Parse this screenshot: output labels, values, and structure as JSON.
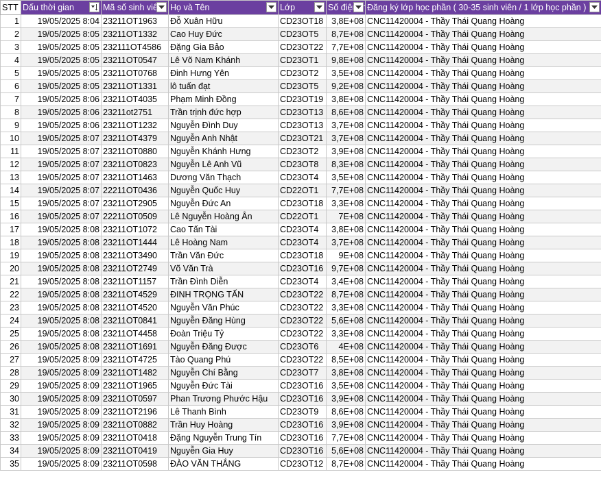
{
  "columns": [
    {
      "label": "STT",
      "filter": false
    },
    {
      "label": "Dấu thời gian",
      "filter": true,
      "filter_icon": "sort-filter-icon"
    },
    {
      "label": "Mã số sinh viên",
      "filter": true,
      "filter_icon": "dropdown-icon"
    },
    {
      "label": "Họ và Tên",
      "filter": true,
      "filter_icon": "dropdown-icon"
    },
    {
      "label": "Lớp",
      "filter": true,
      "filter_icon": "dropdown-icon"
    },
    {
      "label": "Số điện thoại",
      "filter": true,
      "filter_icon": "dropdown-icon"
    },
    {
      "label": "Đăng ký lớp học phần ( 30-35 sinh viên / 1 lớp học phần )",
      "filter": true,
      "filter_icon": "dropdown-icon"
    }
  ],
  "header_color": "#6b3fa0",
  "rows": [
    [
      "1",
      "19/05/2025 8:04",
      "23211OT1963",
      "Đỗ Xuân Hữu",
      "CD23OT18",
      "3,8E+08",
      "CNC11420004 - Thầy Thái Quang Hoàng"
    ],
    [
      "2",
      "19/05/2025 8:05",
      "23211OT1332",
      "Cao Huy Đức",
      "CD23OT5",
      "8,7E+08",
      "CNC11420004 - Thầy Thái Quang Hoàng"
    ],
    [
      "3",
      "19/05/2025 8:05",
      "232111OT4586",
      "Đặng Gia Bảo",
      "CD23OT22",
      "7,7E+08",
      "CNC11420004 - Thầy Thái Quang Hoàng"
    ],
    [
      "4",
      "19/05/2025 8:05",
      "23211OT0547",
      "Lê Võ Nam Khánh",
      "CD23OT1",
      "9,8E+08",
      "CNC11420004 - Thầy Thái Quang Hoàng"
    ],
    [
      "5",
      "19/05/2025 8:05",
      "23211OT0768",
      "Đinh Hưng Yên",
      "CD23OT2",
      "3,5E+08",
      "CNC11420004 - Thầy Thái Quang Hoàng"
    ],
    [
      "6",
      "19/05/2025 8:05",
      "23211OT1331",
      "lô tuấn đạt",
      "CD23OT5",
      "9,2E+08",
      "CNC11420004 - Thầy Thái Quang Hoàng"
    ],
    [
      "7",
      "19/05/2025 8:06",
      "23211OT4035",
      "Phạm Minh Đồng",
      "CD23OT19",
      "3,8E+08",
      "CNC11420004 - Thầy Thái Quang Hoàng"
    ],
    [
      "8",
      "19/05/2025 8:06",
      "23211ot2751",
      "Trần trịnh đức hợp",
      "CD23OT13",
      "8,6E+08",
      "CNC11420004 - Thầy Thái Quang Hoàng"
    ],
    [
      "9",
      "19/05/2025 8:06",
      "23211OT1232",
      "Nguyễn Đình Duy",
      "CD23OT13",
      "3,7E+08",
      "CNC11420004 - Thầy Thái Quang Hoàng"
    ],
    [
      "10",
      "19/05/2025 8:07",
      "23211OT4379",
      "Nguyễn Anh Nhật",
      "CD23OT21",
      "3,7E+08",
      "CNC11420004 - Thầy Thái Quang Hoàng"
    ],
    [
      "11",
      "19/05/2025 8:07",
      "23211OT0880",
      "Nguyễn Khánh Hưng",
      "CD23OT2",
      "3,9E+08",
      "CNC11420004 - Thầy Thái Quang Hoàng"
    ],
    [
      "12",
      "19/05/2025 8:07",
      "23211OT0823",
      "Nguyễn Lê Anh Vũ",
      "CD23OT8",
      "8,3E+08",
      "CNC11420004 - Thầy Thái Quang Hoàng"
    ],
    [
      "13",
      "19/05/2025 8:07",
      "23211OT1463",
      "Dương Văn Thạch",
      "CD23OT4",
      "3,5E+08",
      "CNC11420004 - Thầy Thái Quang Hoàng"
    ],
    [
      "14",
      "19/05/2025 8:07",
      "22211OT0436",
      "Nguyễn Quốc Huy",
      "CD22OT1",
      "7,7E+08",
      "CNC11420004 - Thầy Thái Quang Hoàng"
    ],
    [
      "15",
      "19/05/2025 8:07",
      "23211OT2905",
      "Nguyễn Đức An",
      "CD23OT18",
      "3,3E+08",
      "CNC11420004 - Thầy Thái Quang Hoàng"
    ],
    [
      "16",
      "19/05/2025 8:07",
      "22211OT0509",
      "Lê Nguyễn Hoàng Ân",
      "CD22OT1",
      "7E+08",
      "CNC11420004 - Thầy Thái Quang Hoàng"
    ],
    [
      "17",
      "19/05/2025 8:08",
      "23211OT1072",
      "Cao Tấn Tài",
      "CD23OT4",
      "3,8E+08",
      "CNC11420004 - Thầy Thái Quang Hoàng"
    ],
    [
      "18",
      "19/05/2025 8:08",
      "23211OT1444",
      "Lê Hoàng Nam",
      "CD23OT4",
      "3,7E+08",
      "CNC11420004 - Thầy Thái Quang Hoàng"
    ],
    [
      "19",
      "19/05/2025 8:08",
      "23211OT3490",
      "Trần Văn Đức",
      "CD23OT18",
      "9E+08",
      "CNC11420004 - Thầy Thái Quang Hoàng"
    ],
    [
      "20",
      "19/05/2025 8:08",
      "23211OT2749",
      "Võ Văn Trà",
      "CD23OT16",
      "9,7E+08",
      "CNC11420004 - Thầy Thái Quang Hoàng"
    ],
    [
      "21",
      "19/05/2025 8:08",
      "23211OT1157",
      "Trần Đình Diễn",
      "CD23OT4",
      "3,4E+08",
      "CNC11420004 - Thầy Thái Quang Hoàng"
    ],
    [
      "22",
      "19/05/2025 8:08",
      "23211OT4529",
      "ĐINH TRỌNG TẤN",
      "CD23OT22",
      "8,7E+08",
      "CNC11420004 - Thầy Thái Quang Hoàng"
    ],
    [
      "23",
      "19/05/2025 8:08",
      "23211OT4520",
      "Nguyễn Văn Phúc",
      "CD23OT22",
      "3,3E+08",
      "CNC11420004 - Thầy Thái Quang Hoàng"
    ],
    [
      "24",
      "19/05/2025 8:08",
      "23211OT0841",
      "Nguyễn Đăng Hùng",
      "CD23OT22",
      "5,6E+08",
      "CNC11420004 - Thầy Thái Quang Hoàng"
    ],
    [
      "25",
      "19/05/2025 8:08",
      "23211OT4458",
      "Đoàn Triệu Tỷ",
      "CD23OT22",
      "3,3E+08",
      "CNC11420004 - Thầy Thái Quang Hoàng"
    ],
    [
      "26",
      "19/05/2025 8:08",
      "23211OT1691",
      "Nguyễn Đăng Được",
      "CD23OT6",
      "4E+08",
      "CNC11420004 - Thầy Thái Quang Hoàng"
    ],
    [
      "27",
      "19/05/2025 8:09",
      "23211OT4725",
      "Tào Quang Phú",
      "CD23OT22",
      "8,5E+08",
      "CNC11420004 - Thầy Thái Quang Hoàng"
    ],
    [
      "28",
      "19/05/2025 8:09",
      "23211OT1482",
      "Nguyễn Chí Bằng",
      "CD23OT7",
      "3,8E+08",
      "CNC11420004 - Thầy Thái Quang Hoàng"
    ],
    [
      "29",
      "19/05/2025 8:09",
      "23211OT1965",
      "Nguyễn Đức Tài",
      "CD23OT16",
      "3,5E+08",
      "CNC11420004 - Thầy Thái Quang Hoàng"
    ],
    [
      "30",
      "19/05/2025 8:09",
      "23211OT0597",
      "Phan Trương Phước Hậu",
      "CD23OT16",
      "3,9E+08",
      "CNC11420004 - Thầy Thái Quang Hoàng"
    ],
    [
      "31",
      "19/05/2025 8:09",
      "23211OT2196",
      "Lê Thanh Bình",
      "CD23OT9",
      "8,6E+08",
      "CNC11420004 - Thầy Thái Quang Hoàng"
    ],
    [
      "32",
      "19/05/2025 8:09",
      "23211OT0882",
      "Trần Huy Hoàng",
      "CD23OT16",
      "3,9E+08",
      "CNC11420004 - Thầy Thái Quang Hoàng"
    ],
    [
      "33",
      "19/05/2025 8:09",
      "23211OT0418",
      "Đặng Nguyễn Trung Tín",
      "CD23OT16",
      "7,7E+08",
      "CNC11420004 - Thầy Thái Quang Hoàng"
    ],
    [
      "34",
      "19/05/2025 8:09",
      "23211OT0419",
      "Nguyễn Gia Huy",
      "CD23OT16",
      "5,6E+08",
      "CNC11420004 - Thầy Thái Quang Hoàng"
    ],
    [
      "35",
      "19/05/2025 8:09",
      "23211OT0598",
      "ĐÀO VĂN THẮNG",
      "CD23OT12",
      "8,7E+08",
      "CNC11420004 - Thầy Thái Quang Hoàng"
    ]
  ]
}
